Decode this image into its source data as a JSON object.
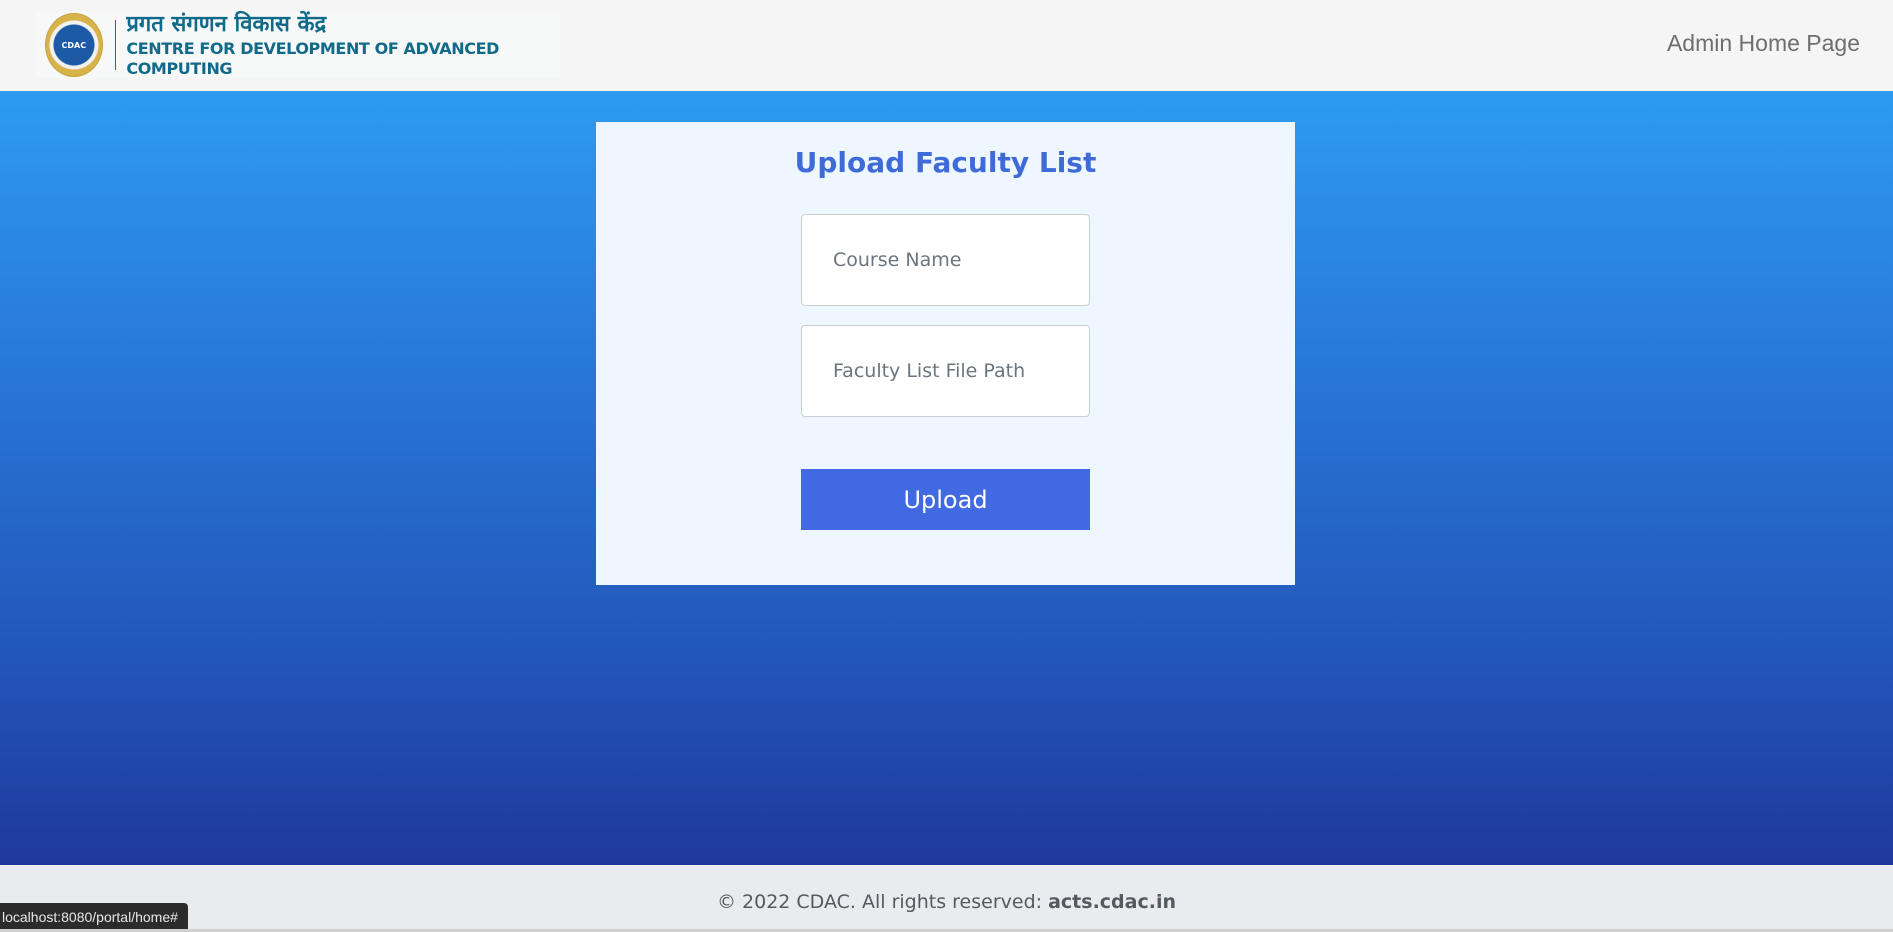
{
  "header": {
    "logo_hindi": "प्रगत संगणन विकास केंद्र",
    "logo_english": "CENTRE FOR DEVELOPMENT OF ADVANCED COMPUTING",
    "logo_seal_text": "CDAC",
    "nav_link": "Admin Home Page"
  },
  "form": {
    "title": "Upload Faculty List",
    "course_placeholder": "Course Name",
    "path_placeholder": "Faculty List File Path",
    "upload_label": "Upload"
  },
  "footer": {
    "copyright": "© 2022 CDAC. All rights reserved: ",
    "link": "acts.cdac.in"
  },
  "status_bar": {
    "url": "localhost:8080/portal/home#"
  },
  "colors": {
    "card_title": "#3e6bd8",
    "button": "#4169e1",
    "gradient_top": "#2d9bf0",
    "gradient_bottom": "#1f389f"
  }
}
